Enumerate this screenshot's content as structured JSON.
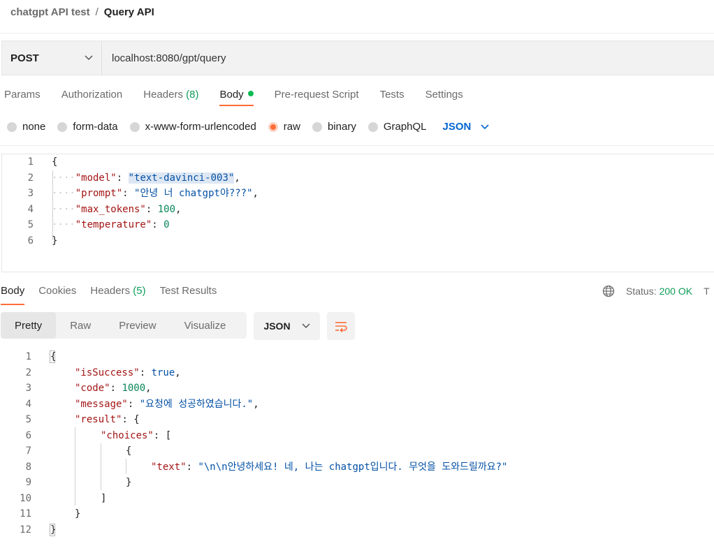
{
  "breadcrumb": {
    "parent": "chatgpt API test",
    "separator": "/",
    "current": "Query API"
  },
  "request": {
    "method": "POST",
    "url": "localhost:8080/gpt/query"
  },
  "request_tabs": [
    {
      "label": "Params"
    },
    {
      "label": "Authorization"
    },
    {
      "label": "Headers",
      "count": "(8)"
    },
    {
      "label": "Body"
    },
    {
      "label": "Pre-request Script"
    },
    {
      "label": "Tests"
    },
    {
      "label": "Settings"
    }
  ],
  "body_types": [
    "none",
    "form-data",
    "x-www-form-urlencoded",
    "raw",
    "binary",
    "GraphQL"
  ],
  "body_format": "JSON",
  "request_body_lines": {
    "n": [
      "1",
      "2",
      "3",
      "4",
      "5",
      "6"
    ],
    "l1": "{",
    "l2_key": "\"model\"",
    "l2_val": "\"text-davinci-003\"",
    "l3_key": "\"prompt\"",
    "l3_val": "\"안녕 너 chatgpt야???\"",
    "l4_key": "\"max_tokens\"",
    "l4_val": "100",
    "l5_key": "\"temperature\"",
    "l5_val": "0",
    "l6": "}"
  },
  "response_tabs": [
    {
      "label": "Body"
    },
    {
      "label": "Cookies"
    },
    {
      "label": "Headers",
      "count": "(5)"
    },
    {
      "label": "Test Results"
    }
  ],
  "status": {
    "label": "Status:",
    "value": "200 OK",
    "trailing": "T"
  },
  "view_modes": [
    "Pretty",
    "Raw",
    "Preview",
    "Visualize"
  ],
  "response_format": "JSON",
  "response_lines": {
    "n": [
      "1",
      "2",
      "3",
      "4",
      "5",
      "6",
      "7",
      "8",
      "9",
      "10",
      "11",
      "12"
    ],
    "isSuccess_key": "\"isSuccess\"",
    "isSuccess_val": "true",
    "code_key": "\"code\"",
    "code_val": "1000",
    "message_key": "\"message\"",
    "message_val": "\"요청에 성공하였습니다.\"",
    "result_key": "\"result\"",
    "choices_key": "\"choices\"",
    "text_key": "\"text\"",
    "text_val": "\"\\n\\n안녕하세요! 네, 나는 chatgpt입니다. 무엇을 도와드릴까요?\""
  },
  "colors": {
    "accent": "#ff6c37",
    "link": "#0265d2",
    "success": "#0f9d58"
  }
}
